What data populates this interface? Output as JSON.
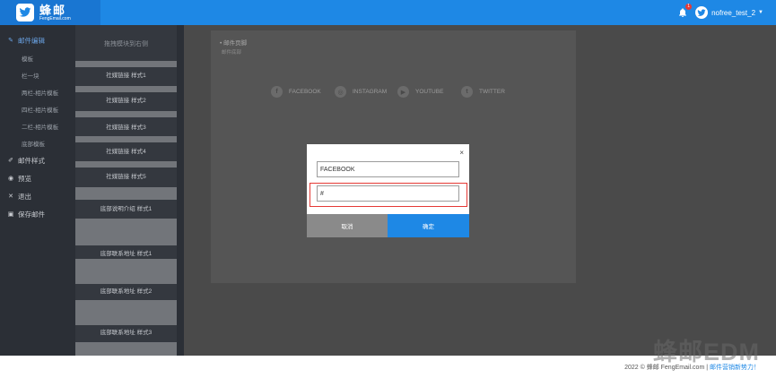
{
  "header": {
    "logo_cn": "蜂邮",
    "logo_en": "FengEmail.com",
    "notification_count": "1",
    "username": "nofree_test_2"
  },
  "sidebar": {
    "nav": [
      {
        "label": "邮件编辑",
        "icon": "edit-icon",
        "active": true
      },
      {
        "label": "模板",
        "sub": true
      },
      {
        "label": "栏一块",
        "sub": true
      },
      {
        "label": "两栏-相片模板",
        "sub": true
      },
      {
        "label": "四栏-相片模板",
        "sub": true
      },
      {
        "label": "二栏-相片模板",
        "sub": true
      },
      {
        "label": "底部模板",
        "sub": true
      },
      {
        "label": "邮件样式",
        "icon": "brush-icon"
      },
      {
        "label": "预览",
        "icon": "eye-icon"
      },
      {
        "label": "退出",
        "icon": "close-icon"
      },
      {
        "label": "保存邮件",
        "icon": "save-icon"
      }
    ],
    "template_panel_title": "拖拽模块到右侧",
    "templates": [
      "社媒链接 样式1",
      "社媒链接 样式2",
      "社媒链接 样式3",
      "社媒链接 样式4",
      "社媒链接 样式5",
      "底部说明介绍 样式1",
      "底部联系地址 样式1",
      "底部联系地址 样式2",
      "底部联系地址 样式3"
    ]
  },
  "editor": {
    "section_title": "• 邮件页脚",
    "section_sub": "邮件底部",
    "socials": [
      {
        "label": "FACEBOOK",
        "icon": "facebook-icon",
        "glyph": "f"
      },
      {
        "label": "INSTAGRAM",
        "icon": "instagram-icon",
        "glyph": "◎"
      },
      {
        "label": "YOUTUBE",
        "icon": "youtube-icon",
        "glyph": "▶"
      },
      {
        "label": "TWITTER",
        "icon": "twitter-icon",
        "glyph": "t"
      }
    ]
  },
  "modal": {
    "close_label": "×",
    "name_value": "FACEBOOK",
    "link_value": "#",
    "cancel_label": "取消",
    "ok_label": "确定"
  },
  "footer": {
    "watermark": "蜂邮EDM",
    "copyright": "2022 © 蜂邮 FengEmail.com |",
    "slogan": "邮件营销新势力！"
  },
  "colors": {
    "primary": "#1e88e5",
    "highlight": "#e53935",
    "cancel": "#8a8a8a"
  }
}
